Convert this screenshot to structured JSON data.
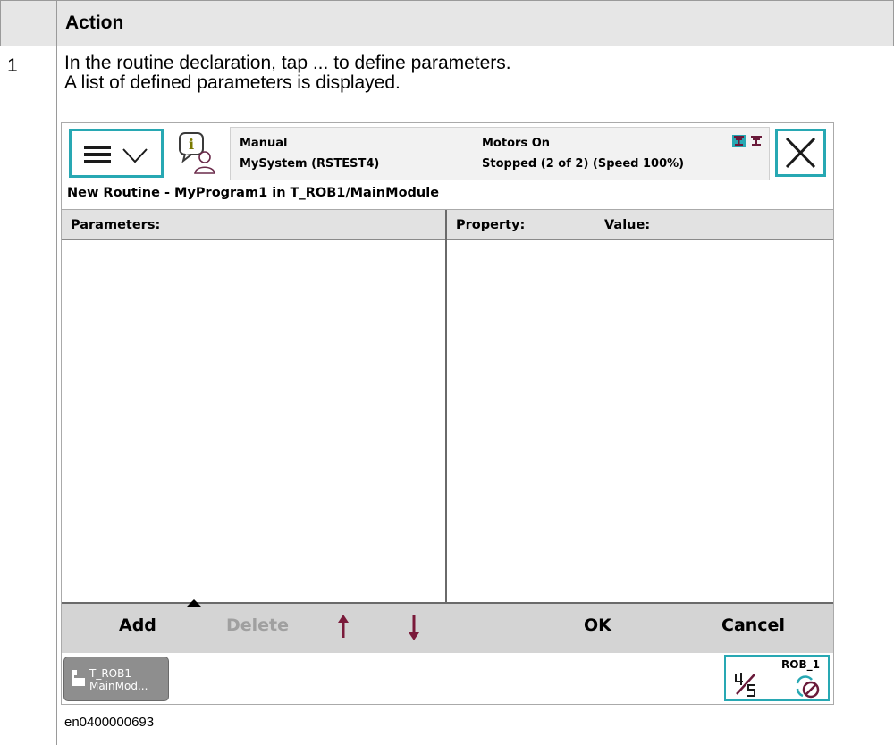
{
  "table": {
    "header_action": "Action",
    "step_number": "1",
    "step_line1": "In the routine declaration, tap ... to define parameters.",
    "step_line2": "A list of defined parameters is displayed.",
    "caption": "en0400000693"
  },
  "pendant": {
    "status": {
      "mode": "Manual",
      "system": "MySystem (RSTEST4)",
      "motors": "Motors On",
      "state": "Stopped (2 of 2) (Speed 100%)"
    },
    "title": "New Routine - MyProgram1 in T_ROB1/MainModule",
    "columns": {
      "parameters": "Parameters:",
      "property": "Property:",
      "value": "Value:"
    },
    "commands": {
      "add": "Add",
      "delete": "Delete",
      "ok": "OK",
      "cancel": "Cancel"
    },
    "taskbar": {
      "task_line1": "T_ROB1",
      "task_line2": "MainMod...",
      "robot": "ROB_1"
    },
    "colors": {
      "accent": "#28a8b3",
      "arrows": "#7a1a3a",
      "command_bar": "#d4d4d4"
    },
    "icons": [
      "menu-icon",
      "chevron-down-icon",
      "event-log-info-icon",
      "robot-status-icon",
      "close-icon",
      "arrow-up-icon",
      "arrow-down-icon",
      "program-module-icon",
      "speed-fraction-icon",
      "jog-disabled-icon"
    ]
  }
}
